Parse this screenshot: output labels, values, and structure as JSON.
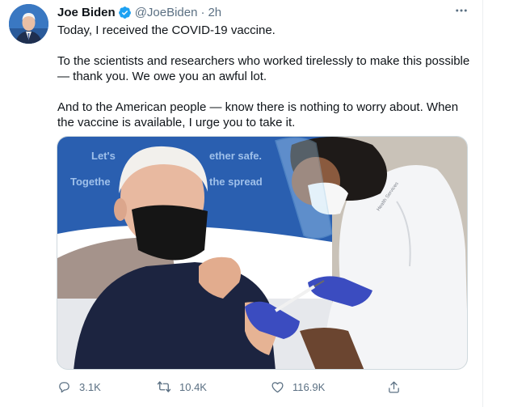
{
  "author": {
    "display_name": "Joe Biden",
    "handle": "@JoeBiden",
    "separator": "·",
    "time": "2h",
    "verified": true,
    "verified_color": "#1da1f2"
  },
  "tweet": {
    "paragraphs": [
      "Today, I received the COVID-19 vaccine.",
      "To the scientists and researchers who worked tirelessly to make this possible — thank you. We owe you an awful lot.",
      "And to the American people — know there is nothing to worry about. When the vaccine is available, I urge you to take it."
    ]
  },
  "media": {
    "banner_line1": "Let's ... ether safe.",
    "banner_line1_left": "Let's",
    "banner_line1_right": "ether safe.",
    "banner_line2_left": "Togethe",
    "banner_line2_right": "the spread",
    "coat_text": "Health Services"
  },
  "actions": {
    "reply_count": "3.1K",
    "retweet_count": "10.4K",
    "like_count": "116.9K"
  },
  "icons": {
    "more": "more-horizontal-icon",
    "reply": "reply-icon",
    "retweet": "retweet-icon",
    "like": "heart-icon",
    "share": "share-icon"
  },
  "colors": {
    "text": "#0f1419",
    "secondary": "#5b7083",
    "brand_blue": "#1da1f2"
  }
}
